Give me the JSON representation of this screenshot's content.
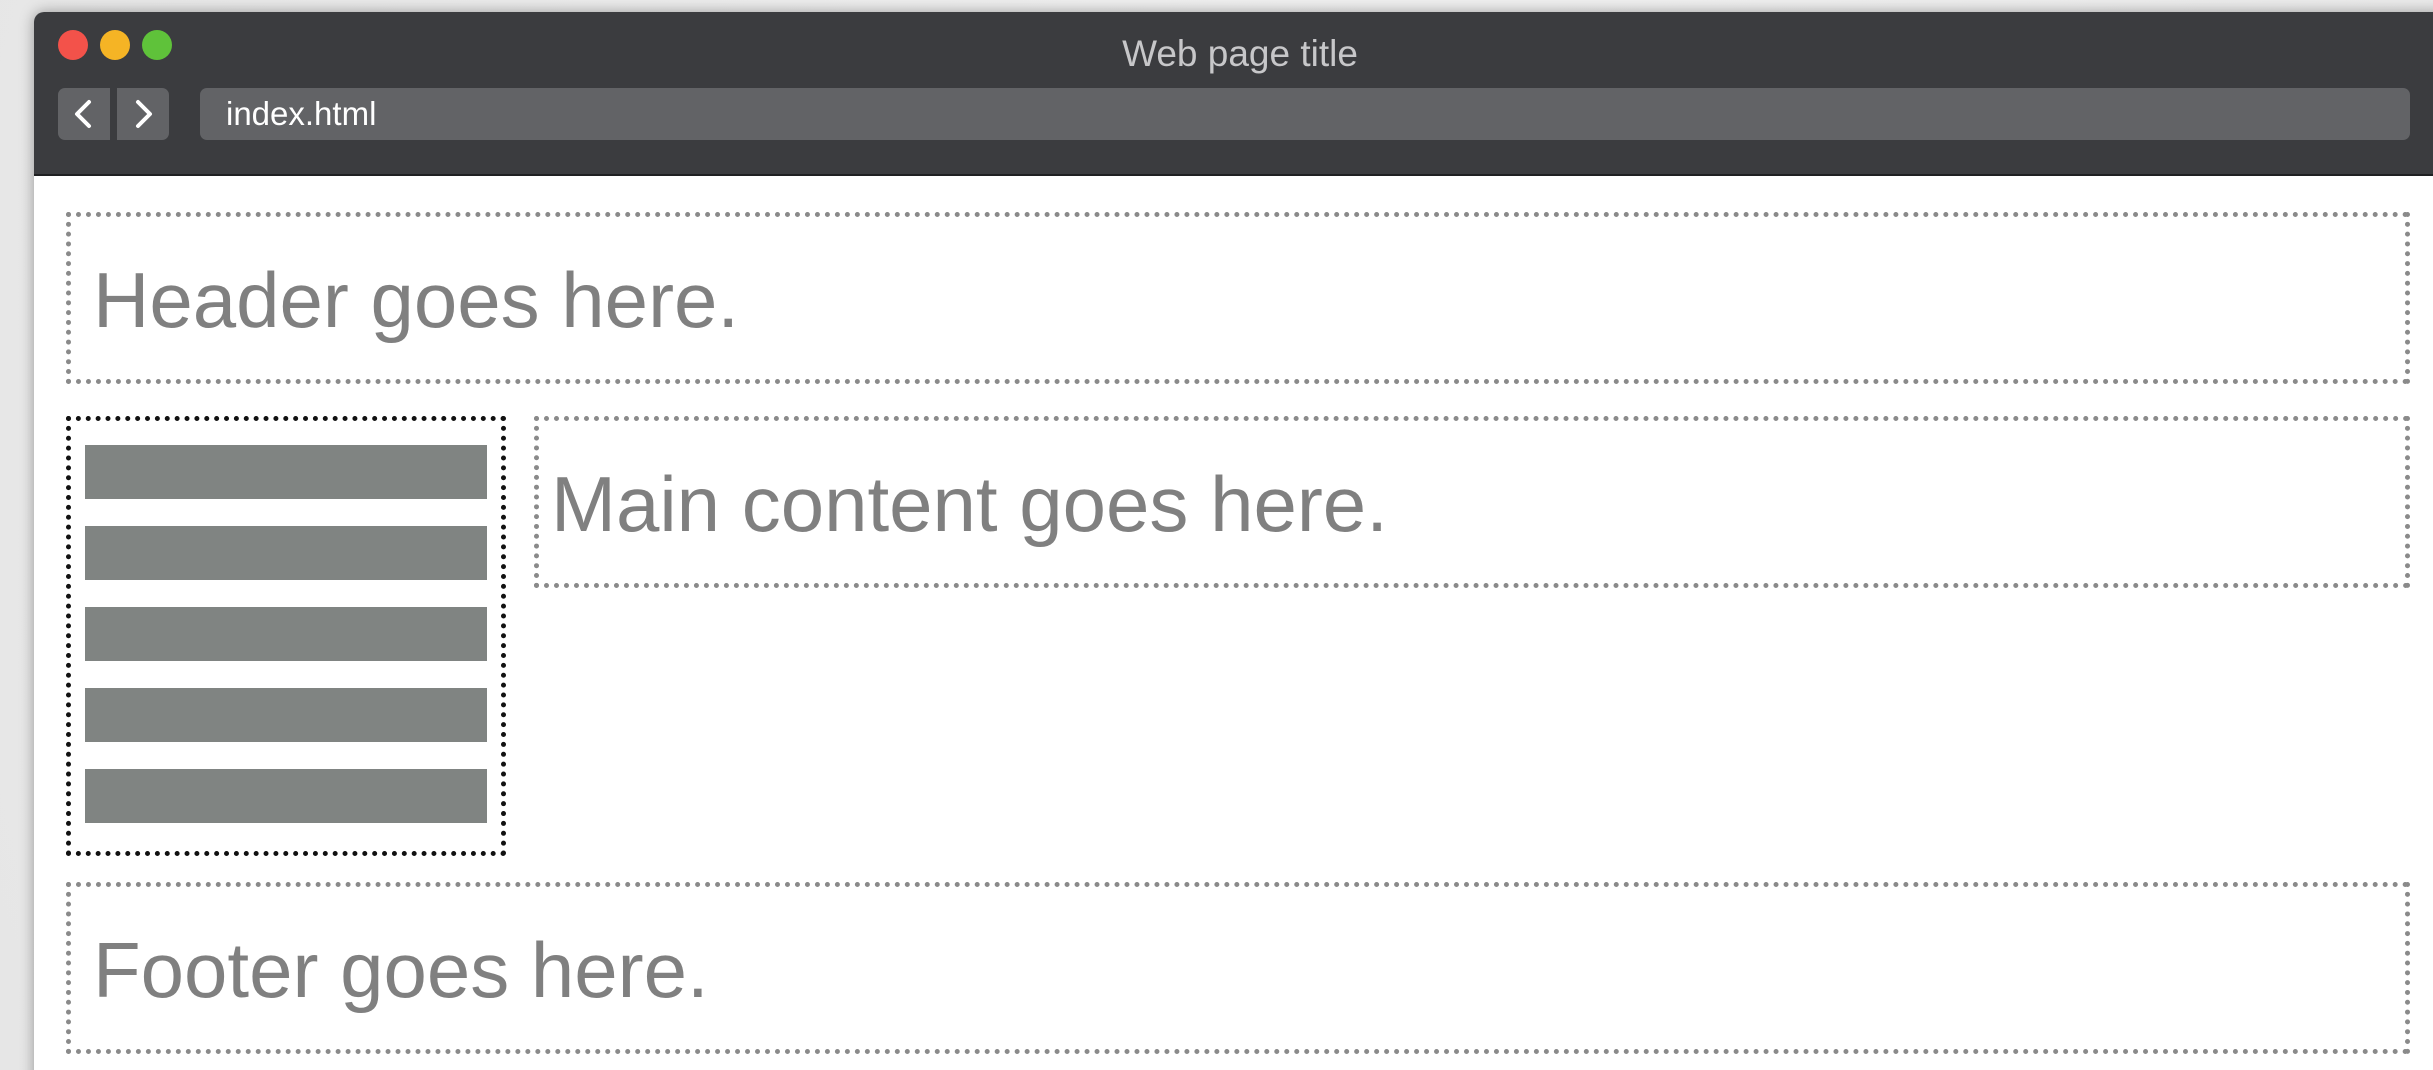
{
  "window": {
    "title": "Web page title",
    "traffic_lights": {
      "close_color": "#f3524a",
      "minimize_color": "#f5b425",
      "zoom_color": "#5fc23a"
    }
  },
  "toolbar": {
    "back_icon": "chevron-left-icon",
    "forward_icon": "chevron-right-icon",
    "url": "index.html"
  },
  "page": {
    "header_text": "Header goes here.",
    "main_text": "Main content goes here.",
    "footer_text": "Footer goes here.",
    "nav_item_count_visible": 5
  },
  "colors": {
    "chrome_bg": "#3b3c3f",
    "urlbar_bg": "#626366",
    "placeholder_text": "#808080",
    "nav_bar_fill": "#808482"
  }
}
